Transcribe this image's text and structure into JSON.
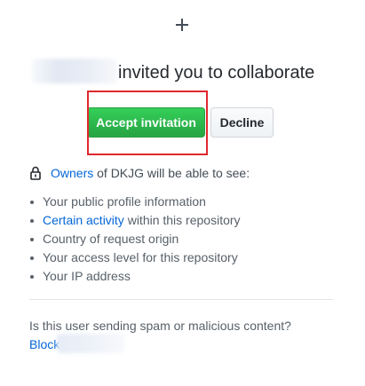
{
  "header": {
    "icon": "plus-icon",
    "invite_text": "invited you to collaborate"
  },
  "actions": {
    "accept_label": "Accept invitation",
    "decline_label": "Decline"
  },
  "permissions": {
    "icon": "lock-icon",
    "owners_link": "Owners",
    "intro_rest": " of DKJG will be able to see:",
    "items": [
      {
        "text": "Your public profile information"
      },
      {
        "link": "Certain activity",
        "text": " within this repository"
      },
      {
        "text": "Country of request origin"
      },
      {
        "text": "Your access level for this repository"
      },
      {
        "text": "Your IP address"
      }
    ]
  },
  "spam": {
    "question": "Is this user sending spam or malicious content?",
    "block_label": "Block"
  },
  "colors": {
    "accept_green": "#28a745",
    "link_blue": "#0366d6",
    "highlight_red": "#e0282e"
  }
}
